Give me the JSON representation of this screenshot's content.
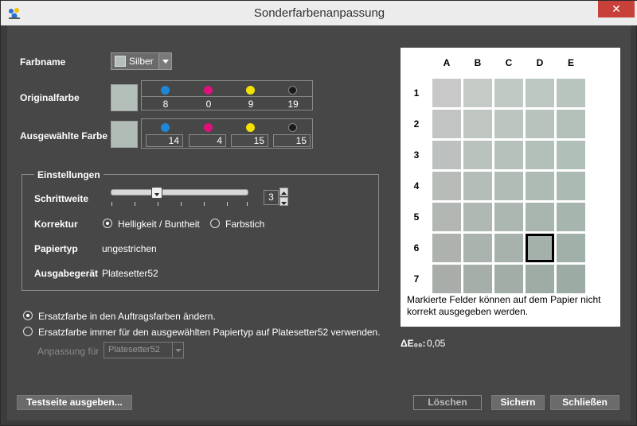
{
  "window": {
    "title": "Sonderfarbenanpassung",
    "close_label": "✕",
    "icon": "app-icon"
  },
  "farbname": {
    "label": "Farbname",
    "value": "Silber"
  },
  "originalfarbe": {
    "label": "Originalfarbe",
    "swatch_color": "#b5bfb9",
    "values": [
      "8",
      "0",
      "9",
      "19"
    ]
  },
  "ausgewaehlte_farbe": {
    "label": "Ausgewählte Farbe",
    "swatch_color": "#b2bcb6",
    "values": [
      "14",
      "4",
      "15",
      "15"
    ]
  },
  "ink_colors": {
    "cyan": "#1e88d8",
    "magenta": "#e0107a",
    "yellow": "#f2e200",
    "black": "#1a1a1a"
  },
  "einstellungen": {
    "title": "Einstellungen",
    "schrittweite_label": "Schrittweite",
    "schrittweite_value": "3",
    "slider_level": 0.33,
    "korrektur_label": "Korrektur",
    "korrektur_options": [
      "Helligkeit / Buntheit",
      "Farbstich"
    ],
    "korrektur_selected": 0,
    "papiertyp_label": "Papiertyp",
    "papiertyp_value": "ungestrichen",
    "ausgabegeraet_label": "Ausgabegerät",
    "ausgabegeraet_value": "Platesetter52"
  },
  "ersatz": {
    "option1": "Ersatzfarbe in den Auftragsfarben ändern.",
    "option2": "Ersatzfarbe immer für den ausgewählten Papiertyp auf Platesetter52 verwenden.",
    "selected": 0,
    "anpassung_label": "Anpassung für",
    "anpassung_value": "Platesetter52"
  },
  "grid": {
    "columns": [
      "A",
      "B",
      "C",
      "D",
      "E"
    ],
    "rows": [
      "1",
      "2",
      "3",
      "4",
      "5",
      "6",
      "7"
    ],
    "selected": {
      "row": 6,
      "col": "D"
    },
    "note": "Markierte Felder können auf dem Papier nicht korrekt ausgegeben werden.",
    "cell_colors": [
      [
        "#c8c8c8",
        "#c4cbc7",
        "#c0c9c4",
        "#bcc7c1",
        "#b8c5be"
      ],
      [
        "#c2c3c3",
        "#bfc6c2",
        "#bcc5c0",
        "#b8c3bd",
        "#b4c1ba"
      ],
      [
        "#bcc0be",
        "#b9c2bd",
        "#b6c1bb",
        "#b3c0b9",
        "#b0bfb7"
      ],
      [
        "#b7bcb9",
        "#b4bdb8",
        "#b1bcb6",
        "#aebbb4",
        "#abbab2"
      ],
      [
        "#b2b7b4",
        "#afb8b3",
        "#acb7b1",
        "#a9b6af",
        "#a6b5ad"
      ],
      [
        "#adb2af",
        "#aab3ae",
        "#a7b2ac",
        "#a4b1aa",
        "#a1b0a8"
      ],
      [
        "#a8adaa",
        "#a5aea9",
        "#a2ada7",
        "#9faca5",
        "#9caba3"
      ]
    ]
  },
  "delta_e": {
    "label": "ΔE₀₀:",
    "value": "0,05"
  },
  "buttons": {
    "testseite": "Testseite ausgeben...",
    "loeschen": "Löschen",
    "sichern": "Sichern",
    "schliessen": "Schließen"
  }
}
